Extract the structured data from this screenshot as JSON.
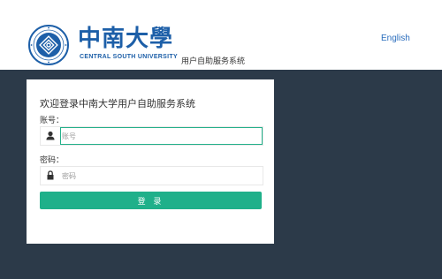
{
  "header": {
    "university_name": "中南大學",
    "university_name_en": "CENTRAL SOUTH UNIVERSITY",
    "system_title": "用户自助服务系统",
    "language_link": "English"
  },
  "login": {
    "welcome": "欢迎登录中南大学用户自助服务系统",
    "username_label": "账号：",
    "username_placeholder": "账号",
    "password_label": "密码：",
    "password_placeholder": "密码",
    "submit_label": "登 录"
  },
  "colors": {
    "brand_blue": "#1d5fa8",
    "dark_background": "#2c3a49",
    "button_green": "#1fb08a"
  },
  "icons": {
    "username": "user-icon",
    "password": "lock-icon"
  }
}
